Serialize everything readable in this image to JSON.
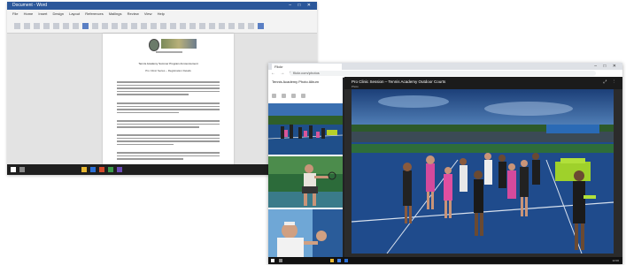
{
  "word": {
    "title": "Document - Word",
    "window_controls": "– □ ✕",
    "ribbon_tabs": [
      "File",
      "Home",
      "Insert",
      "Design",
      "Layout",
      "References",
      "Mailings",
      "Review",
      "View",
      "Help"
    ],
    "doc_heading": "Tennis Academy Summer Program Announcement",
    "doc_subheading": "Pro Clinic Series – Registration Details",
    "accent_color": "#2b579a"
  },
  "browser": {
    "tab_label": "Flickr",
    "window_controls": "– □ ✕",
    "nav_icons": "← → ⟳",
    "url": "flickr.com/photos",
    "sidebar_title": "Tennis Academy Photo Album",
    "main_title": "Pro Clinic Session – Tennis Academy Outdoor Courts",
    "main_subtitle": "Photo",
    "main_icons": "⤢ ⋮",
    "clock": "12:00"
  }
}
